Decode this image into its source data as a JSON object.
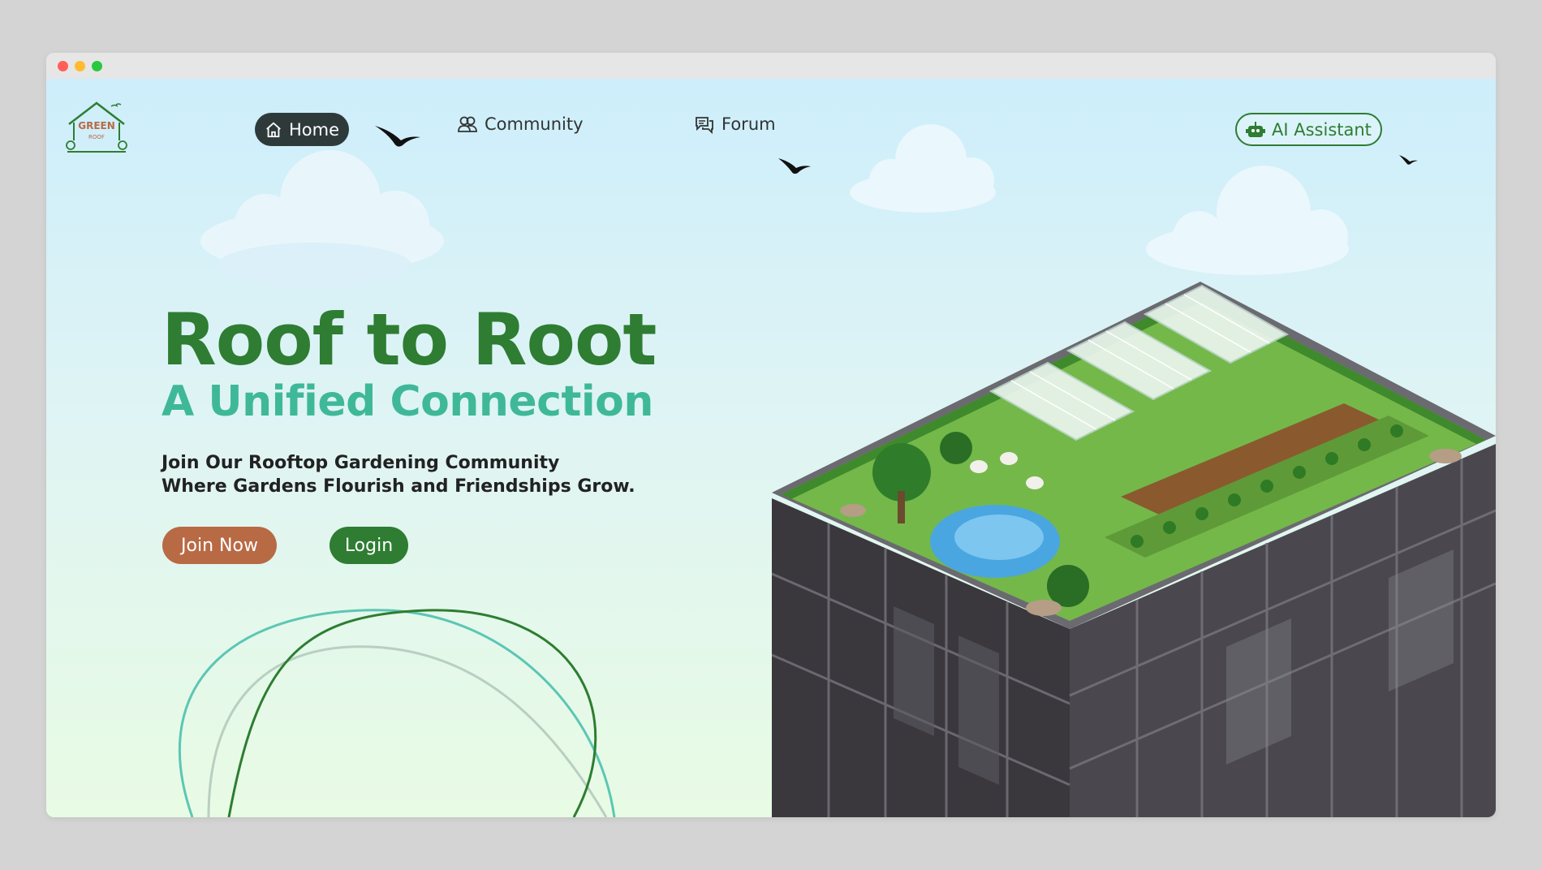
{
  "nav": {
    "logo_text_top": "GREEN",
    "logo_text_bottom": "ROOF",
    "home_label": "Home",
    "community_label": "Community",
    "forum_label": "Forum",
    "ai_label": "AI Assistant"
  },
  "hero": {
    "title": "Roof to Root",
    "subtitle": "A Unified Connection",
    "desc_line1": "Join Our Rooftop Gardening Community",
    "desc_line2": "Where Gardens Flourish and Friendships Grow."
  },
  "actions": {
    "join_label": "Join Now",
    "login_label": "Login"
  },
  "colors": {
    "primary_green": "#2e7d32",
    "teal": "#3fb89a",
    "join_button": "#b86a45",
    "nav_active": "#2e3a3a"
  },
  "icons": [
    "home-icon",
    "community-icon",
    "forum-icon",
    "robot-icon"
  ]
}
